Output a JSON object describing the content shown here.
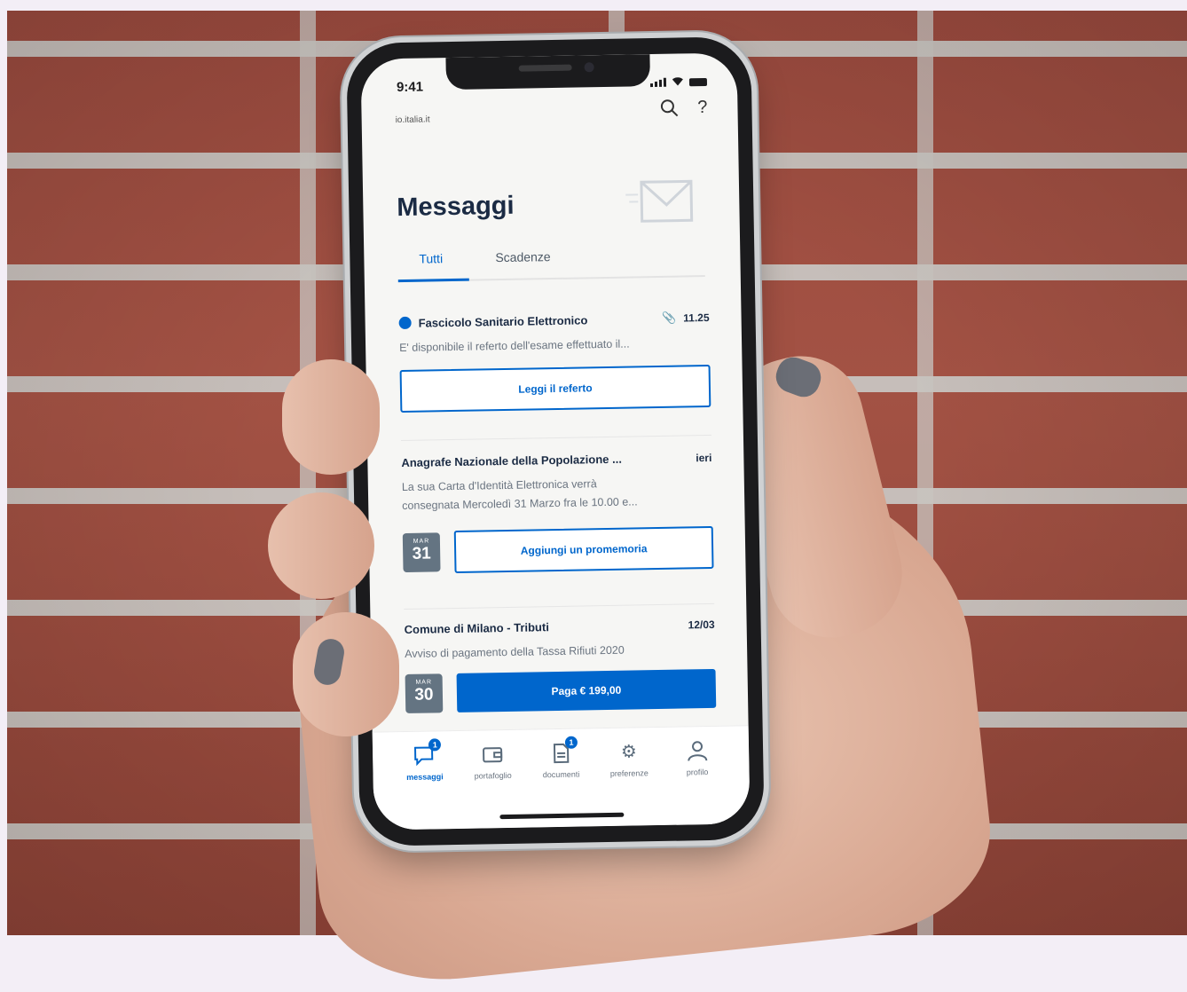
{
  "status": {
    "time": "9:41"
  },
  "header": {
    "domain": "io.italia.it"
  },
  "page": {
    "title": "Messaggi"
  },
  "tabs": [
    {
      "label": "Tutti"
    },
    {
      "label": "Scadenze"
    }
  ],
  "messages": [
    {
      "sender": "Fascicolo Sanitario Elettronico",
      "time": "11.25",
      "preview": "E' disponibile il referto dell'esame effettuato il...",
      "action": "Leggi il referto"
    },
    {
      "sender": "Anagrafe Nazionale della Popolazione ...",
      "time": "ieri",
      "preview_line1": "La sua Carta d'Identità Elettronica verrà",
      "preview_line2": "consegnata Mercoledì 31 Marzo fra le 10.00 e...",
      "calendar_month": "MAR",
      "calendar_day": "31",
      "action": "Aggiungi un promemoria"
    },
    {
      "sender": "Comune di Milano - Tributi",
      "time": "12/03",
      "preview": "Avviso di pagamento della Tassa Rifiuti 2020",
      "calendar_month": "MAR",
      "calendar_day": "30",
      "action": "Paga € 199,00"
    }
  ],
  "tabbar": [
    {
      "label": "messaggi",
      "icon": "chat-icon",
      "badge": "1"
    },
    {
      "label": "portafoglio",
      "icon": "wallet-icon"
    },
    {
      "label": "documenti",
      "icon": "document-icon",
      "badge": "1"
    },
    {
      "label": "preferenze",
      "icon": "gear-icon"
    },
    {
      "label": "profilo",
      "icon": "user-icon"
    }
  ],
  "colors": {
    "accent": "#0066cc",
    "title": "#1b2b44",
    "calendar": "#647482"
  }
}
